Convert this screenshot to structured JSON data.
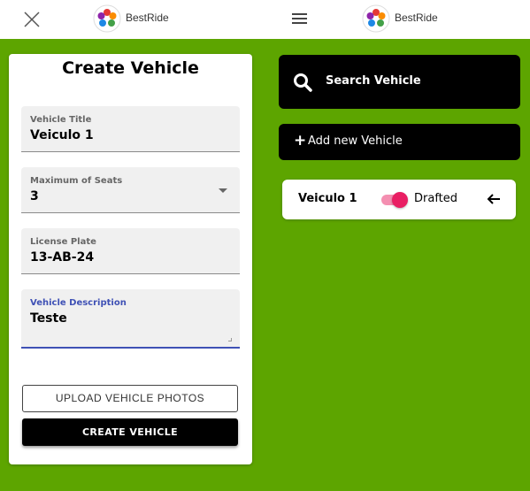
{
  "header": {
    "brand_left": "BestRide",
    "brand_right": "BestRide",
    "close_icon": "close-icon",
    "menu_icon": "hamburger-icon",
    "logo_icon": "bestride-logo"
  },
  "form": {
    "title": "Create Vehicle",
    "fields": [
      {
        "label": "Vehicle Title",
        "value": "Veiculo 1"
      },
      {
        "label": "Maximum of Seats",
        "value": "3"
      },
      {
        "label": "License Plate",
        "value": "13-AB-24"
      },
      {
        "label": "Vehicle Description",
        "value": "Teste"
      }
    ],
    "upload_label": "UPLOAD VEHICLE PHOTOS",
    "create_label": "CREATE VEHICLE"
  },
  "sidebar": {
    "search_label": "Search Vehicle",
    "add_label": "Add new Vehicle",
    "vehicles": [
      {
        "name": "Veiculo 1",
        "status": "Drafted",
        "toggle_on": true
      }
    ]
  },
  "colors": {
    "background": "#5da500",
    "accent_focus": "#3f51b5",
    "toggle": "#e91e63"
  }
}
